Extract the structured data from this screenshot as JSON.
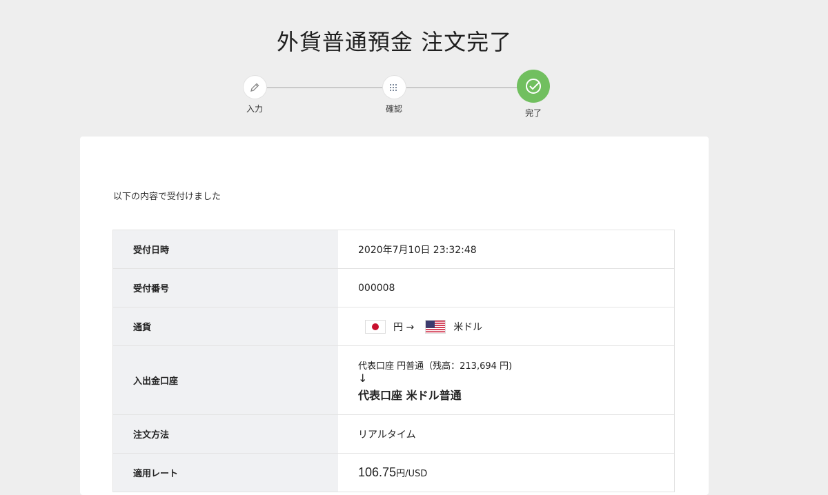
{
  "page": {
    "title": "外貨普通預金 注文完了"
  },
  "steps": [
    {
      "label": "入力",
      "icon": "pencil-icon"
    },
    {
      "label": "確認",
      "icon": "checklist-icon"
    },
    {
      "label": "完了",
      "icon": "check-circle-icon"
    }
  ],
  "colors": {
    "active_step": "#71bf5f",
    "background": "#eeeeee",
    "header_cell": "#f0f1f3"
  },
  "intro": "以下の内容で受付けました",
  "rows": {
    "date": {
      "label": "受付日時",
      "value": "2020年7月10日 23:32:48"
    },
    "number": {
      "label": "受付番号",
      "value": "000008"
    },
    "currency": {
      "label": "通貨",
      "from": "円 →",
      "to": "米ドル",
      "from_flag": "japan-flag-icon",
      "to_flag": "usa-flag-icon"
    },
    "account": {
      "label": "入出金口座",
      "from": "代表口座 円普通（残高：213,694 円)",
      "arrow": "↓",
      "to": "代表口座 米ドル普通"
    },
    "method": {
      "label": "注文方法",
      "value": "リアルタイム"
    },
    "rate": {
      "label": "適用レート",
      "value": "106.75",
      "unit": "円/USD"
    }
  }
}
